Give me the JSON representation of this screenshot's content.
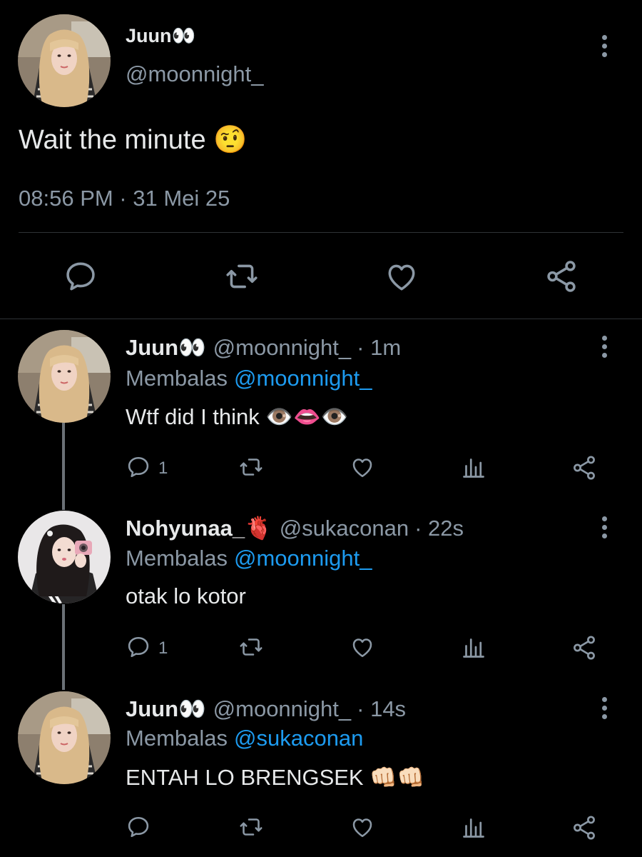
{
  "main_tweet": {
    "display_name": "Juun👀",
    "handle": "@moonnight_",
    "text": "Wait the minute 🤨",
    "timestamp": "08:56 PM · 31 Mei 25"
  },
  "replies": [
    {
      "display_name": "Juun👀",
      "handle": "@moonnight_",
      "time": "· 1m",
      "replying_prefix": "Membalas",
      "replying_to": "@moonnight_",
      "text": "Wtf did I think 👁️👄👁️",
      "reply_count": "1"
    },
    {
      "display_name": "Nohyunaa_🫀",
      "handle": "@sukaconan",
      "time": "· 22s",
      "replying_prefix": "Membalas",
      "replying_to": "@moonnight_",
      "text": "otak lo kotor",
      "reply_count": "1"
    },
    {
      "display_name": "Juun👀",
      "handle": "@moonnight_",
      "time": "· 14s",
      "replying_prefix": "Membalas",
      "replying_to": "@sukaconan",
      "text": "ENTAH LO BRENGSEK 👊🏻👊🏻",
      "reply_count": ""
    }
  ],
  "icons": [
    "comment-icon",
    "retweet-icon",
    "heart-icon",
    "share-icon",
    "views-icon",
    "more-vertical-icon"
  ],
  "colors": {
    "background": "#000000",
    "text": "#e7e9ea",
    "muted": "#8b98a5",
    "link": "#1d9bf0",
    "divider": "#2f3336"
  }
}
